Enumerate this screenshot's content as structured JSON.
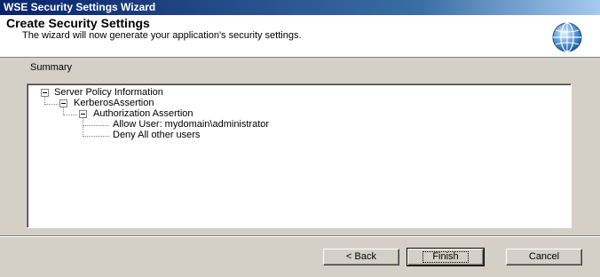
{
  "window": {
    "title": "WSE Security Settings Wizard"
  },
  "header": {
    "title": "Create Security Settings",
    "subtitle": "The wizard will now generate your application's security settings.",
    "icon": "globe-icon"
  },
  "summary": {
    "label": "Summary",
    "tree": {
      "root": "Server Policy Information",
      "child": "KerberosAssertion",
      "grandchild": "Authorization Assertion",
      "leaves": [
        "Allow User: mydomain\\administrator",
        "Deny All other users"
      ]
    }
  },
  "buttons": {
    "back": "< Back",
    "finish": "Finish",
    "cancel": "Cancel"
  },
  "colors": {
    "titlebar_start": "#0a246a",
    "titlebar_end": "#a6caf0",
    "dialog_bg": "#d4d0c8"
  }
}
